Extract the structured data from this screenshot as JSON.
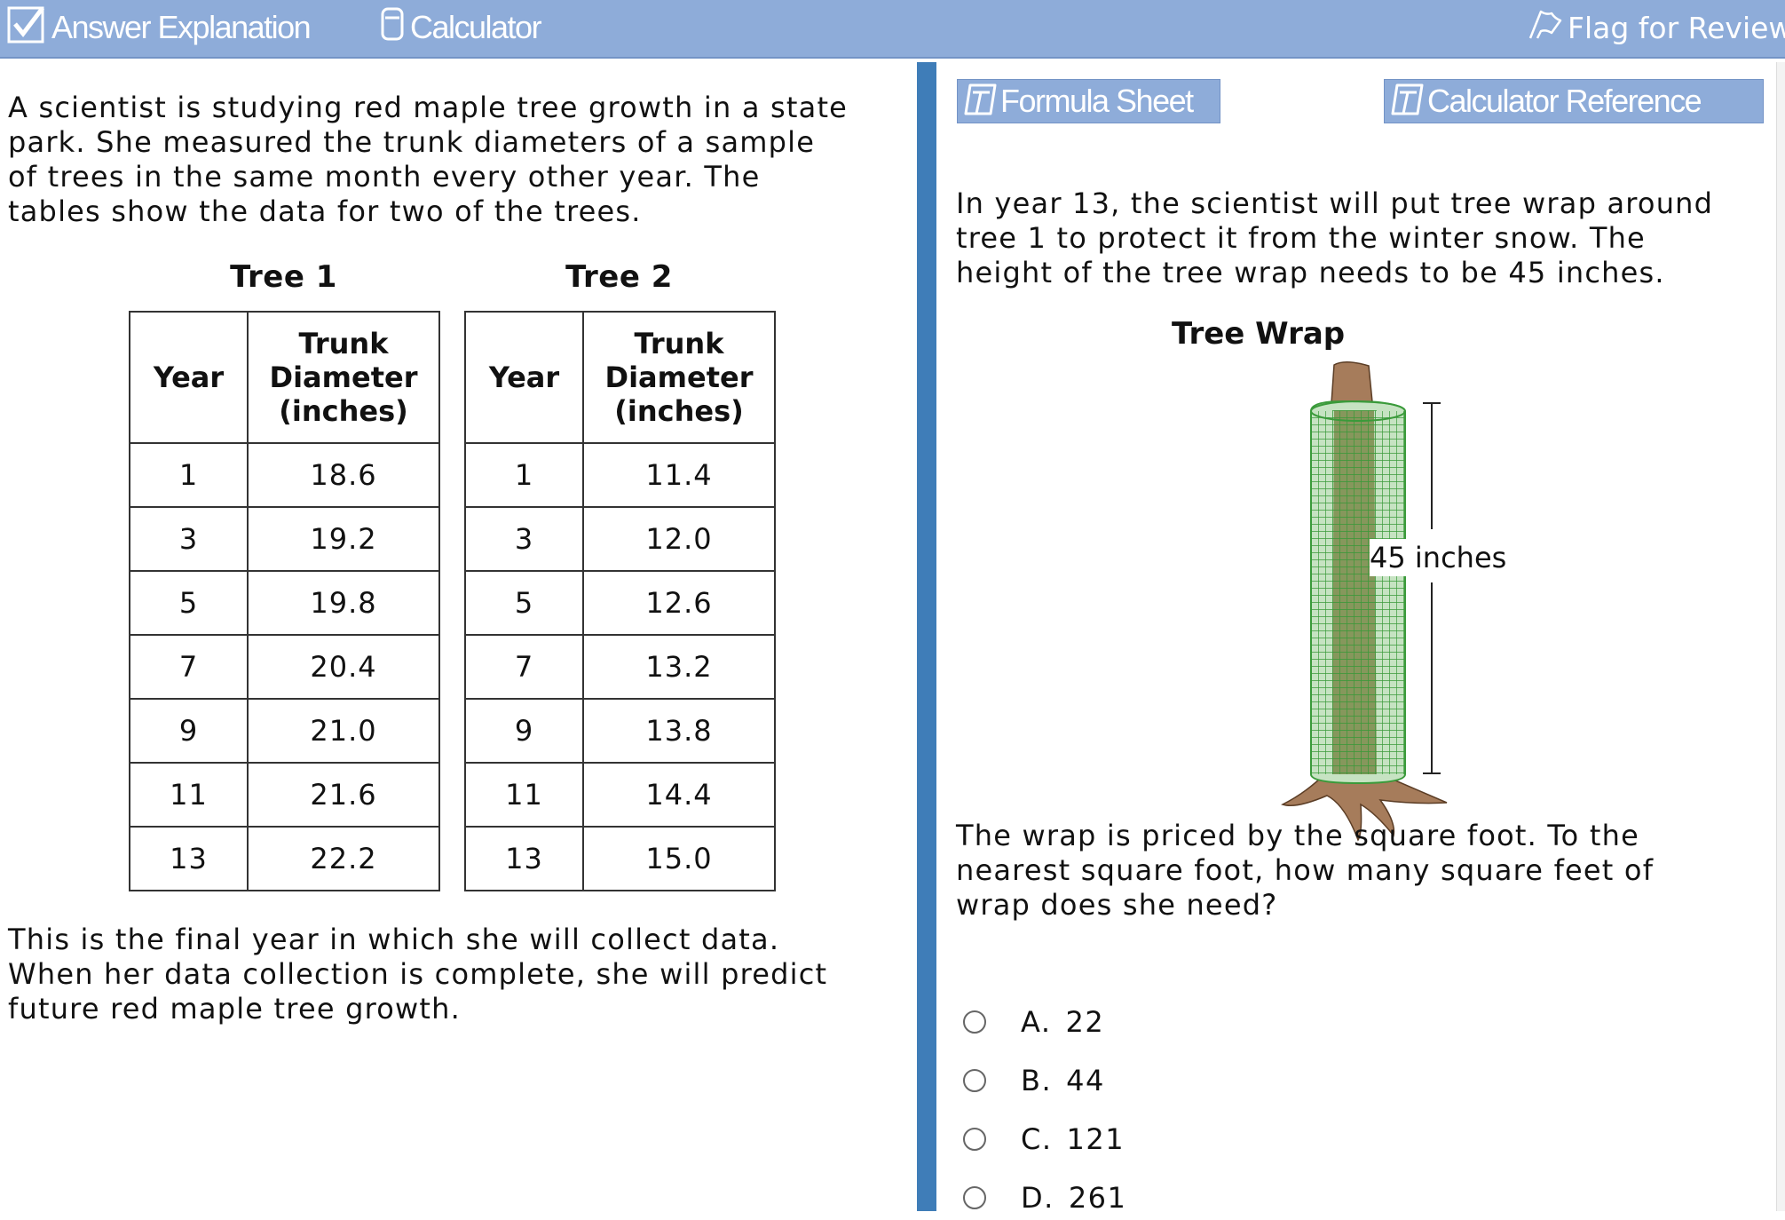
{
  "toolbar": {
    "answer_explanation": "Answer Explanation",
    "calculator": "Calculator",
    "flag_for_review": "Flag for Review"
  },
  "passage": {
    "intro": "A scientist is studying red maple tree growth in a state\npark. She measured the trunk diameters of a sample\nof trees in the same month every other year. The\ntables show the data for two of the trees.",
    "outro": "This is the final year in which she will collect data.\nWhen her data collection is complete, she will predict\nfuture red maple tree growth."
  },
  "tables": [
    {
      "caption": "Tree 1",
      "headers": [
        "Year",
        "Trunk\nDiameter\n(inches)"
      ],
      "rows": [
        [
          "1",
          "18.6"
        ],
        [
          "3",
          "19.2"
        ],
        [
          "5",
          "19.8"
        ],
        [
          "7",
          "20.4"
        ],
        [
          "9",
          "21.0"
        ],
        [
          "11",
          "21.6"
        ],
        [
          "13",
          "22.2"
        ]
      ]
    },
    {
      "caption": "Tree 2",
      "headers": [
        "Year",
        "Trunk\nDiameter\n(inches)"
      ],
      "rows": [
        [
          "1",
          "11.4"
        ],
        [
          "3",
          "12.0"
        ],
        [
          "5",
          "12.6"
        ],
        [
          "7",
          "13.2"
        ],
        [
          "9",
          "13.8"
        ],
        [
          "11",
          "14.4"
        ],
        [
          "13",
          "15.0"
        ]
      ]
    }
  ],
  "reference_buttons": {
    "formula_sheet": "Formula Sheet",
    "calculator_reference": "Calculator Reference"
  },
  "question": {
    "part_a": "In year 13, the scientist will put tree wrap around\ntree 1 to protect it from the winter snow. The\nheight of the tree wrap needs to be 45 inches.",
    "part_b": "The wrap is priced by the square foot. To the\nnearest square foot, how many square feet of\nwrap does she need?"
  },
  "figure": {
    "title": "Tree Wrap",
    "height_label": "45 inches"
  },
  "choices": [
    {
      "letter": "A.",
      "value": "22"
    },
    {
      "letter": "B.",
      "value": "44"
    },
    {
      "letter": "C.",
      "value": "121"
    },
    {
      "letter": "D.",
      "value": "261"
    }
  ],
  "colors": {
    "toolbar": "#8eacd9",
    "divider": "#3f7db8",
    "trunk": "#a67c5b",
    "wrap_mesh": "#3a9a3a"
  }
}
